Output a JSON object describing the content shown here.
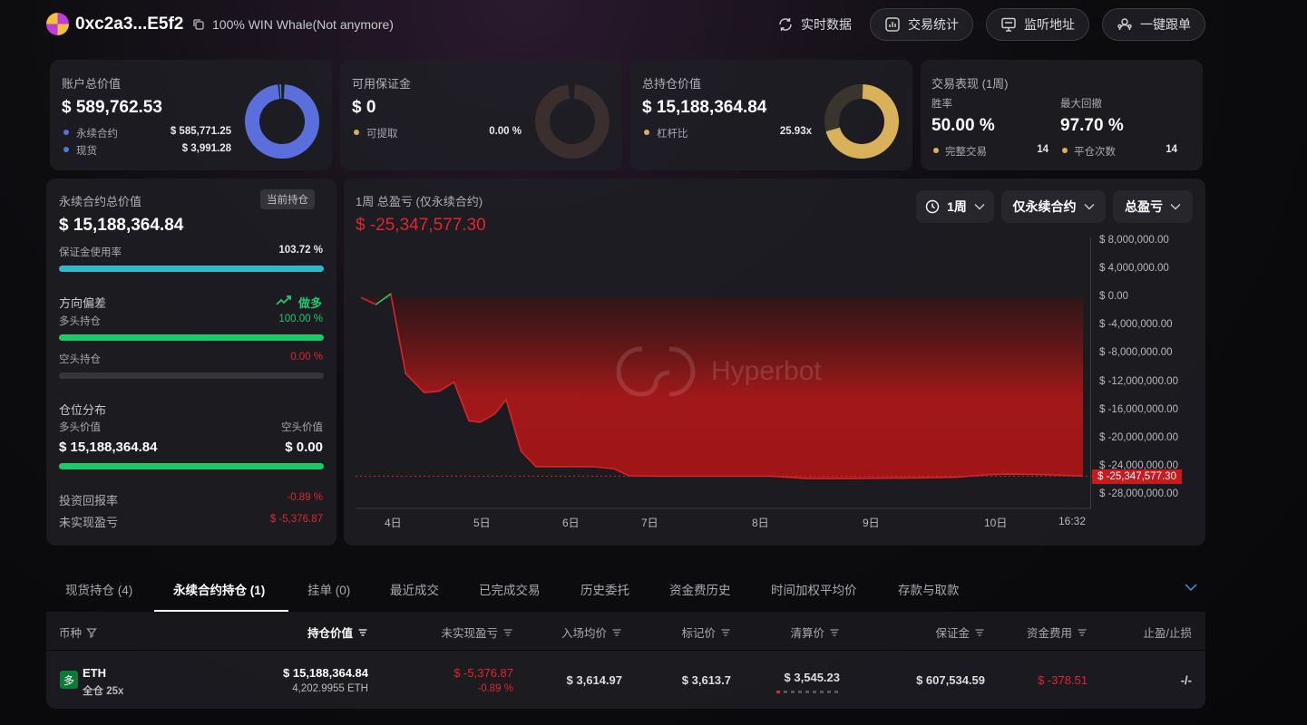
{
  "header": {
    "address": "0xc2a3...E5f2",
    "subtitle": "100% WIN Whale(Not anymore)",
    "buttons": {
      "realtime": "实时数据",
      "stats": "交易统计",
      "monitor": "监听地址",
      "copy_trade": "一键跟单"
    }
  },
  "account": {
    "title": "账户总价值",
    "value": "$ 589,762.53",
    "perp_label": "永续合约",
    "perp_value": "$ 585,771.25",
    "spot_label": "现货",
    "spot_value": "$ 3,991.28",
    "color_perp": "#5b6fdc",
    "color_spot": "#4a7fd0"
  },
  "margin": {
    "title": "可用保证金",
    "value": "$ 0",
    "withdraw_label": "可提取",
    "withdraw_value": "0.00 %"
  },
  "position": {
    "title": "总持仓价值",
    "value": "$ 15,188,364.84",
    "leverage_label": "杠杆比",
    "leverage_value": "25.93x",
    "color": "#d8b15a"
  },
  "performance": {
    "title": "交易表现 (1周)",
    "winrate_label": "胜率",
    "winrate_value": "50.00 %",
    "drawdown_label": "最大回撤",
    "drawdown_value": "97.70 %",
    "completed_label": "完整交易",
    "completed_value": "14",
    "close_label": "平仓次数",
    "close_value": "14"
  },
  "perp_panel": {
    "title": "永续合约总价值",
    "badge": "当前持仓",
    "value": "$ 15,188,364.84",
    "margin_usage_label": "保证金使用率",
    "margin_usage_value": "103.72 %",
    "margin_usage_fraction": 1.0,
    "direction_label": "方向偏差",
    "direction_value": "做多",
    "long_label": "多头持仓",
    "long_value": "100.00 %",
    "long_fraction": 1.0,
    "short_label": "空头持仓",
    "short_value": "0.00 %",
    "short_fraction": 0.0,
    "dist_label": "仓位分布",
    "long_val_label": "多头价值",
    "short_val_label": "空头价值",
    "long_val": "$ 15,188,364.84",
    "short_val": "$ 0.00",
    "roi_label": "投资回报率",
    "roi_value": "-0.89 %",
    "upnl_label": "未实现盈亏",
    "upnl_value": "$ -5,376.87"
  },
  "chart_panel": {
    "title": "1周 总盈亏 (仅永续合约)",
    "value": "$ -25,347,577.30",
    "dd_period": "1周",
    "dd_scope": "仅永续合约",
    "dd_metric": "总盈亏",
    "watermark": "Hyperbot",
    "current_label": "$ -25,347,577.30"
  },
  "chart_data": {
    "type": "area",
    "title": "1周 总盈亏 (仅永续合约)",
    "y_ticks": [
      "$ 8,000,000.00",
      "$ 4,000,000.00",
      "$ 0.00",
      "$ -4,000,000.00",
      "$ -8,000,000.00",
      "$ -12,000,000.00",
      "$ -16,000,000.00",
      "$ -20,000,000.00",
      "$ -24,000,000.00",
      "$ -28,000,000.00"
    ],
    "x_ticks": [
      "4日",
      "5日",
      "6日",
      "7日",
      "8日",
      "9日",
      "10日",
      "16:32"
    ],
    "ylim": [
      -30000000,
      9000000
    ],
    "series": [
      {
        "values": [
          [
            0.0,
            0
          ],
          [
            0.2,
            -1000000
          ],
          [
            0.4,
            500000
          ],
          [
            0.6,
            -10800000
          ],
          [
            0.85,
            -13500000
          ],
          [
            1.05,
            -13300000
          ],
          [
            1.25,
            -12000000
          ],
          [
            1.45,
            -17500000
          ],
          [
            1.6,
            -17700000
          ],
          [
            1.8,
            -16500000
          ],
          [
            1.95,
            -14500000
          ],
          [
            2.15,
            -21800000
          ],
          [
            2.35,
            -24000000
          ],
          [
            2.6,
            -24000000
          ],
          [
            3.1,
            -24000000
          ],
          [
            3.4,
            -24300000
          ],
          [
            3.6,
            -25300000
          ],
          [
            4.0,
            -25350000
          ],
          [
            4.5,
            -25350000
          ],
          [
            5.0,
            -25350000
          ],
          [
            5.5,
            -25350000
          ],
          [
            6.0,
            -25700000
          ],
          [
            6.5,
            -25700000
          ],
          [
            7.0,
            -25650000
          ],
          [
            7.5,
            -25600000
          ],
          [
            8.0,
            -25500000
          ],
          [
            8.4,
            -25150000
          ],
          [
            8.7,
            -25050000
          ],
          [
            9.0,
            -25100000
          ],
          [
            9.4,
            -25200000
          ],
          [
            9.7,
            -25347577
          ]
        ]
      }
    ],
    "current_value": -25347577.3
  },
  "tabs": [
    "现货持仓 (4)",
    "永续合约持仓 (1)",
    "挂单 (0)",
    "最近成交",
    "已完成交易",
    "历史委托",
    "资金费历史",
    "时间加权平均价",
    "存款与取款"
  ],
  "table": {
    "headers": [
      "币种",
      "持仓价值",
      "未实现盈亏",
      "入场均价",
      "标记价",
      "清算价",
      "保证金",
      "资金费用",
      "止盈/止损"
    ],
    "row": {
      "side_badge": "多",
      "coin": "ETH",
      "margin_mode": "全仓 25x",
      "position_value": "$ 15,188,364.84",
      "position_size": "4,202.9955 ETH",
      "upnl": "$ -5,376.87",
      "upnl_pct": "-0.89 %",
      "entry": "$ 3,614.97",
      "mark": "$ 3,613.7",
      "liq": "$ 3,545.23",
      "margin": "$ 607,534.59",
      "funding": "$ -378.51",
      "tpsl": "-/-"
    }
  }
}
